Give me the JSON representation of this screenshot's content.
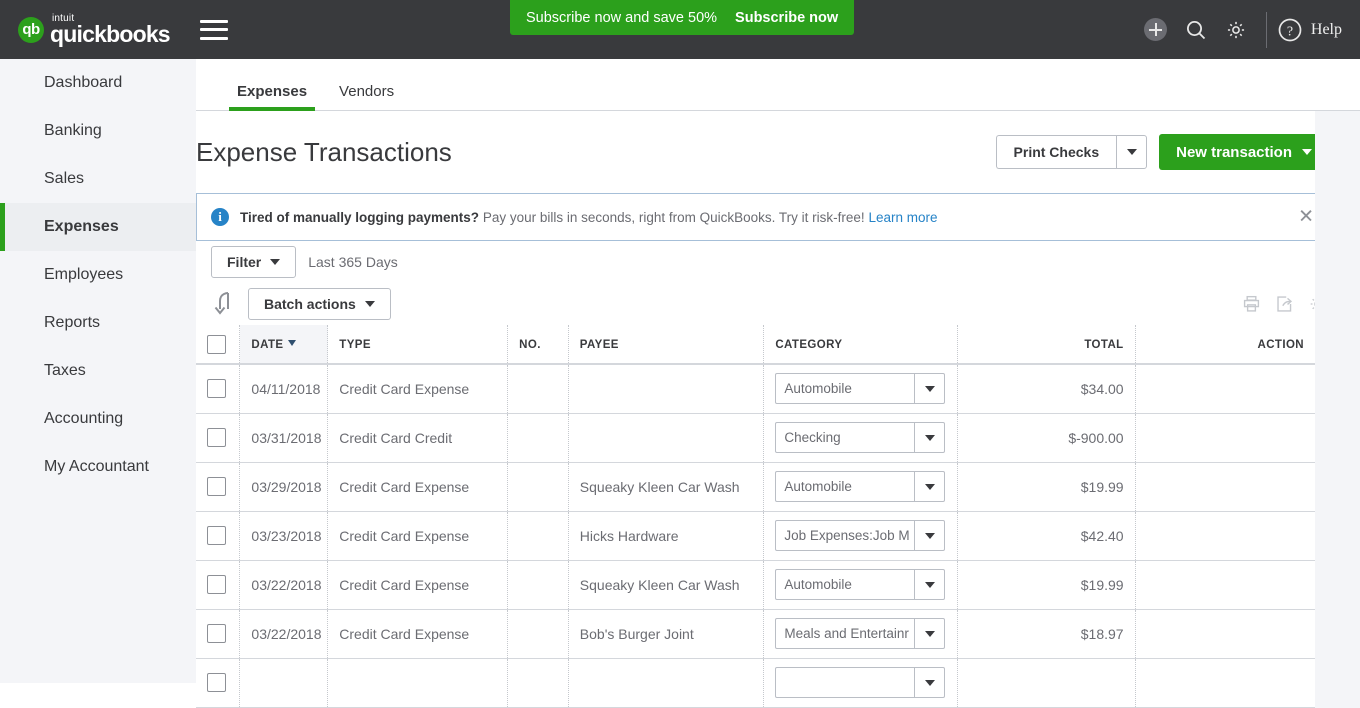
{
  "topbar": {
    "brand_intuit": "intuit",
    "brand_name": "quickbooks",
    "logo_mark": "qb",
    "promo_text": "Subscribe now and save 50%",
    "promo_cta": "Subscribe now",
    "help_label": "Help",
    "help_glyph": "?",
    "info_glyph": "i",
    "bg_color": "#393a3d",
    "accent_green": "#2ca01c"
  },
  "sidebar": {
    "items": [
      {
        "label": "Dashboard",
        "active": false
      },
      {
        "label": "Banking",
        "active": false
      },
      {
        "label": "Sales",
        "active": false
      },
      {
        "label": "Expenses",
        "active": true
      },
      {
        "label": "Employees",
        "active": false
      },
      {
        "label": "Reports",
        "active": false
      },
      {
        "label": "Taxes",
        "active": false
      },
      {
        "label": "Accounting",
        "active": false
      },
      {
        "label": "My Accountant",
        "active": false
      }
    ]
  },
  "tabs": [
    {
      "label": "Expenses",
      "active": true
    },
    {
      "label": "Vendors",
      "active": false
    }
  ],
  "page": {
    "title": "Expense Transactions",
    "print_checks_label": "Print Checks",
    "new_transaction_label": "New transaction"
  },
  "banner": {
    "lead": "Tired of manually logging payments?",
    "body": "Pay your bills in seconds, right from QuickBooks. Try it risk-free!",
    "link": "Learn more",
    "close_glyph": "✕",
    "border_color": "#a6bfd8",
    "icon_color": "#2683c7"
  },
  "toolbar": {
    "filter_label": "Filter",
    "date_range": "Last 365 Days",
    "batch_actions_label": "Batch actions",
    "icons": [
      "print-icon",
      "export-icon",
      "gear-icon"
    ]
  },
  "table": {
    "columns": [
      {
        "key": "checkbox",
        "label": "",
        "align": "left"
      },
      {
        "key": "date",
        "label": "DATE",
        "align": "left",
        "sorted": true
      },
      {
        "key": "type",
        "label": "TYPE",
        "align": "left"
      },
      {
        "key": "no",
        "label": "NO.",
        "align": "left"
      },
      {
        "key": "payee",
        "label": "PAYEE",
        "align": "left"
      },
      {
        "key": "category",
        "label": "CATEGORY",
        "align": "left"
      },
      {
        "key": "total",
        "label": "TOTAL",
        "align": "right"
      },
      {
        "key": "action",
        "label": "ACTION",
        "align": "right"
      }
    ],
    "rows": [
      {
        "date": "04/11/2018",
        "type": "Credit Card Expense",
        "no": "",
        "payee": "",
        "category": "Automobile",
        "total": "$34.00",
        "action": ""
      },
      {
        "date": "03/31/2018",
        "type": "Credit Card Credit",
        "no": "",
        "payee": "",
        "category": "Checking",
        "total": "$-900.00",
        "action": ""
      },
      {
        "date": "03/29/2018",
        "type": "Credit Card Expense",
        "no": "",
        "payee": "Squeaky Kleen Car Wash",
        "category": "Automobile",
        "total": "$19.99",
        "action": ""
      },
      {
        "date": "03/23/2018",
        "type": "Credit Card Expense",
        "no": "",
        "payee": "Hicks Hardware",
        "category": "Job Expenses:Job M",
        "total": "$42.40",
        "action": ""
      },
      {
        "date": "03/22/2018",
        "type": "Credit Card Expense",
        "no": "",
        "payee": "Squeaky Kleen Car Wash",
        "category": "Automobile",
        "total": "$19.99",
        "action": ""
      },
      {
        "date": "03/22/2018",
        "type": "Credit Card Expense",
        "no": "",
        "payee": "Bob's Burger Joint",
        "category": "Meals and Entertainr",
        "total": "$18.97",
        "action": ""
      },
      {
        "date": "",
        "type": "",
        "no": "",
        "payee": "",
        "category": "",
        "total": "",
        "action": ""
      }
    ]
  }
}
